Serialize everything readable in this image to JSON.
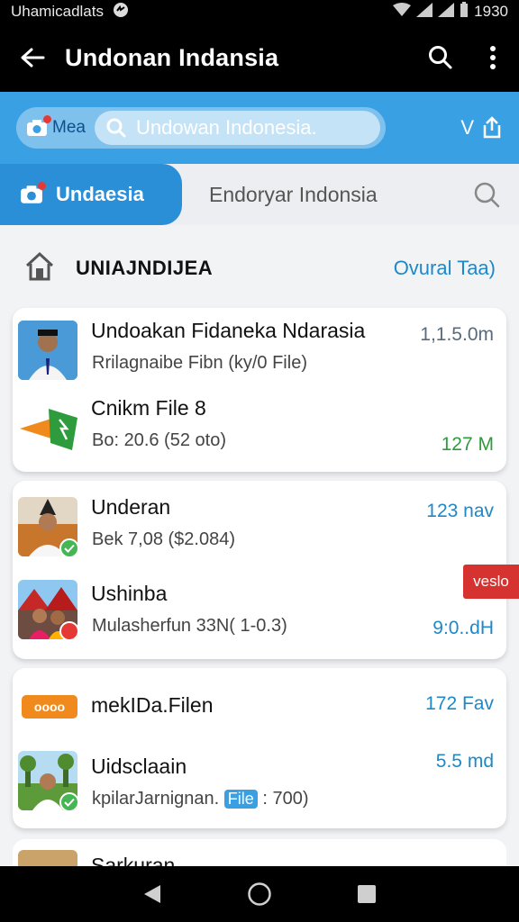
{
  "status_bar": {
    "carrier": "Uhamicadlats",
    "time": "1930"
  },
  "app_bar": {
    "title": "Undonan Indansia"
  },
  "search_band": {
    "chip_label": "Mea",
    "query": "Undowan Indonesia.",
    "right_label": "V"
  },
  "tabs": {
    "active": "Undaesia",
    "inactive": "Endoryar Indonsia"
  },
  "section": {
    "title": "UNIAJNDIJEA",
    "link": "Ovural Taa)"
  },
  "cards": [
    {
      "items": [
        {
          "title": "Undoakan Fidaneka Ndarasia",
          "subtitle": "Rrilagnaibe Fibn (ky/0 File)",
          "meta": "1,1.5.0m"
        },
        {
          "title": "Cnikm File 8",
          "subtitle": "Bo: 20.6 (52 oto)",
          "meta": "127 M"
        }
      ]
    },
    {
      "items": [
        {
          "title": "Underan",
          "subtitle": "Bek 7,08 ($2.084)",
          "meta": "123 nav"
        },
        {
          "title": "Ushinba",
          "subtitle": "Mulasherfun 33N( 1-0.3)",
          "meta": "9:0..dH"
        }
      ],
      "tag": "veslo"
    },
    {
      "items": [
        {
          "title": "mekIDa.Filen",
          "subtitle": "",
          "meta": "172 Fav",
          "badge": "oooo"
        },
        {
          "title": "Uidsclaain",
          "subtitle_pre": "kpilarJarnignan.",
          "subtitle_badge": "File",
          "subtitle_post": ": 700)",
          "meta": "5.5 md"
        }
      ]
    }
  ],
  "peek": {
    "title": "Sarkuran"
  },
  "colors": {
    "accent": "#3aa0e4",
    "tab_active": "#2b8fd8",
    "link": "#1e88c8",
    "ok": "#44b654",
    "tag": "#d6322f"
  }
}
